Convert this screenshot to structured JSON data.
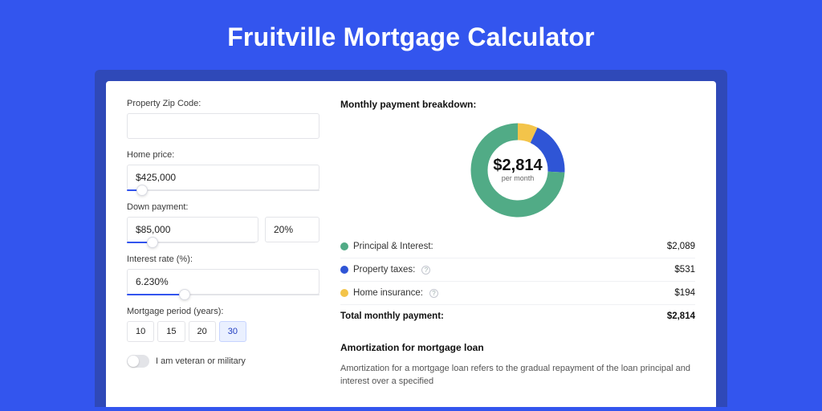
{
  "title": "Fruitville Mortgage Calculator",
  "form": {
    "zip": {
      "label": "Property Zip Code:",
      "value": ""
    },
    "home_price": {
      "label": "Home price:",
      "value": "$425,000",
      "slider_pct": 8
    },
    "down_payment": {
      "label": "Down payment:",
      "amount": "$85,000",
      "pct": "20%",
      "slider_pct": 20
    },
    "interest_rate": {
      "label": "Interest rate (%):",
      "value": "6.230%",
      "slider_pct": 30
    },
    "period": {
      "label": "Mortgage period (years):",
      "options": [
        "10",
        "15",
        "20",
        "30"
      ],
      "selected": "30"
    },
    "veteran": {
      "label": "I am veteran or military",
      "checked": false
    }
  },
  "breakdown": {
    "title": "Monthly payment breakdown:",
    "center_value": "$2,814",
    "center_sub": "per month",
    "items": [
      {
        "label": "Principal & Interest:",
        "value": "$2,089",
        "color": "#51ab86",
        "has_info": false
      },
      {
        "label": "Property taxes:",
        "value": "$531",
        "color": "#2f55d6",
        "has_info": true
      },
      {
        "label": "Home insurance:",
        "value": "$194",
        "color": "#f3c44a",
        "has_info": true
      }
    ],
    "total": {
      "label": "Total monthly payment:",
      "value": "$2,814"
    }
  },
  "amortization": {
    "title": "Amortization for mortgage loan",
    "body": "Amortization for a mortgage loan refers to the gradual repayment of the loan principal and interest over a specified"
  },
  "chart_data": {
    "type": "pie",
    "title": "Monthly payment breakdown",
    "series": [
      {
        "name": "Principal & Interest",
        "value": 2089,
        "color": "#51ab86"
      },
      {
        "name": "Property taxes",
        "value": 531,
        "color": "#2f55d6"
      },
      {
        "name": "Home insurance",
        "value": 194,
        "color": "#f3c44a"
      }
    ],
    "total": 2814,
    "center_label": "$2,814 per month"
  }
}
